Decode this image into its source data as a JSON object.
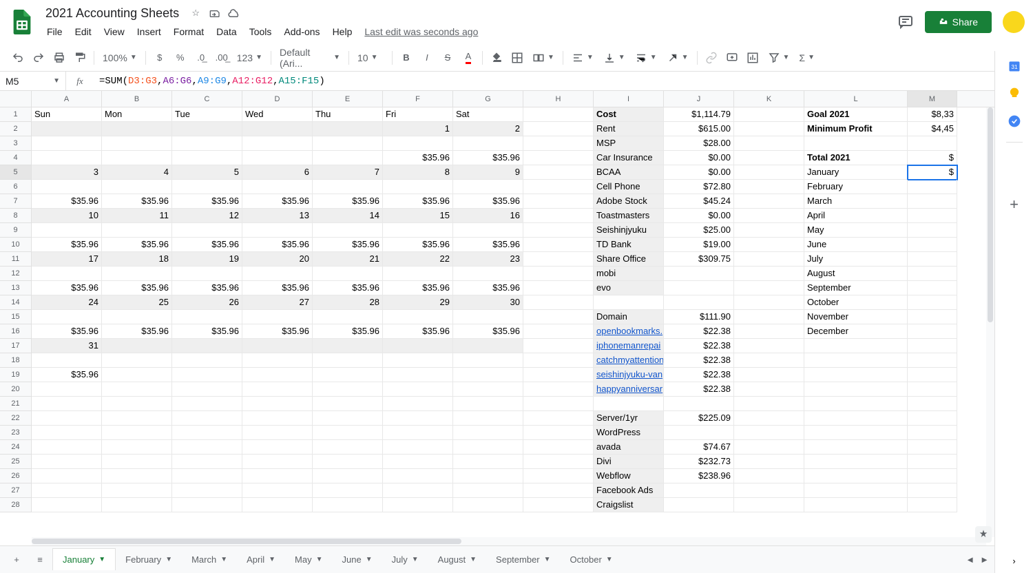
{
  "doc": {
    "title": "2021 Accounting Sheets"
  },
  "menu": {
    "file": "File",
    "edit": "Edit",
    "view": "View",
    "insert": "Insert",
    "format": "Format",
    "data": "Data",
    "tools": "Tools",
    "addons": "Add-ons",
    "help": "Help",
    "lastedit": "Last edit was seconds ago"
  },
  "share": {
    "label": "Share"
  },
  "toolbar": {
    "zoom": "100%",
    "font": "Default (Ari...",
    "size": "10",
    "numfmt": "123"
  },
  "namebox": "M5",
  "formula": {
    "raw": "=SUM(D3:G3,A6:G6,A9:G9,A12:G12,A15:F15)"
  },
  "cols": [
    "A",
    "B",
    "C",
    "D",
    "E",
    "F",
    "G",
    "H",
    "I",
    "J",
    "K",
    "L",
    "M"
  ],
  "rows": 28,
  "activeCell": {
    "row": 5,
    "col": "M"
  },
  "days": {
    "A": "Sun",
    "B": "Mon",
    "C": "Tue",
    "D": "Wed",
    "E": "Thu",
    "F": "Fri",
    "G": "Sat"
  },
  "calendar": {
    "2": {
      "F": "1",
      "G": "2"
    },
    "4": {
      "F": "$35.96",
      "G": "$35.96"
    },
    "5": {
      "A": "3",
      "B": "4",
      "C": "5",
      "D": "6",
      "E": "7",
      "F": "8",
      "G": "9"
    },
    "7": {
      "A": "$35.96",
      "B": "$35.96",
      "C": "$35.96",
      "D": "$35.96",
      "E": "$35.96",
      "F": "$35.96",
      "G": "$35.96"
    },
    "8": {
      "A": "10",
      "B": "11",
      "C": "12",
      "D": "13",
      "E": "14",
      "F": "15",
      "G": "16"
    },
    "10": {
      "A": "$35.96",
      "B": "$35.96",
      "C": "$35.96",
      "D": "$35.96",
      "E": "$35.96",
      "F": "$35.96",
      "G": "$35.96"
    },
    "11": {
      "A": "17",
      "B": "18",
      "C": "19",
      "D": "20",
      "E": "21",
      "F": "22",
      "G": "23"
    },
    "13": {
      "A": "$35.96",
      "B": "$35.96",
      "C": "$35.96",
      "D": "$35.96",
      "E": "$35.96",
      "F": "$35.96",
      "G": "$35.96"
    },
    "14": {
      "A": "24",
      "B": "25",
      "C": "26",
      "D": "27",
      "E": "28",
      "F": "29",
      "G": "30"
    },
    "16": {
      "A": "$35.96",
      "B": "$35.96",
      "C": "$35.96",
      "D": "$35.96",
      "E": "$35.96",
      "F": "$35.96",
      "G": "$35.96"
    },
    "17": {
      "A": "31"
    },
    "19": {
      "A": "$35.96"
    }
  },
  "grayRows": [
    2,
    5,
    8,
    11,
    14,
    17
  ],
  "costs": {
    "1": {
      "I": "Cost",
      "J": "$1,114.79"
    },
    "2": {
      "I": "Rent",
      "J": "$615.00"
    },
    "3": {
      "I": "MSP",
      "J": "$28.00"
    },
    "4": {
      "I": "Car Insurance",
      "J": "$0.00"
    },
    "5": {
      "I": "BCAA",
      "J": "$0.00"
    },
    "6": {
      "I": "Cell Phone",
      "J": "$72.80"
    },
    "7": {
      "I": "Adobe Stock",
      "J": "$45.24"
    },
    "8": {
      "I": "Toastmasters",
      "J": "$0.00"
    },
    "9": {
      "I": "Seishinjyuku",
      "J": "$25.00"
    },
    "10": {
      "I": "TD Bank",
      "J": "$19.00"
    },
    "11": {
      "I": "Share Office",
      "J": "$309.75"
    },
    "12": {
      "I": "mobi",
      "J": ""
    },
    "13": {
      "I": "evo",
      "J": ""
    },
    "15": {
      "I": "Domain",
      "J": "$111.90"
    },
    "16": {
      "I": "openbookmarks.",
      "J": "$22.38",
      "link": true
    },
    "17": {
      "I": "iphonemanrepai",
      "J": "$22.38",
      "link": true
    },
    "18": {
      "I": "catchmyattention",
      "J": "$22.38",
      "link": true
    },
    "19": {
      "I": "seishinjyuku-van",
      "J": "$22.38",
      "link": true
    },
    "20": {
      "I": "happyanniversar",
      "J": "$22.38",
      "link": true
    },
    "22": {
      "I": "Server/1yr",
      "J": "$225.09"
    },
    "23": {
      "I": "WordPress",
      "J": ""
    },
    "24": {
      "I": "avada",
      "J": "$74.67"
    },
    "25": {
      "I": "Divi",
      "J": "$232.73"
    },
    "26": {
      "I": "Webflow",
      "J": "$238.96"
    },
    "27": {
      "I": "Facebook Ads",
      "J": ""
    },
    "28": {
      "I": "Craigslist",
      "J": ""
    }
  },
  "goals": {
    "1": {
      "L": "Goal 2021",
      "M": "$8,33"
    },
    "2": {
      "L": "Minimum Profit",
      "M": "$4,45"
    },
    "4": {
      "L": "Total 2021",
      "M": "$"
    },
    "5": {
      "L": "January",
      "M": "$"
    },
    "6": {
      "L": "February"
    },
    "7": {
      "L": "March"
    },
    "8": {
      "L": "April"
    },
    "9": {
      "L": "May"
    },
    "10": {
      "L": "June"
    },
    "11": {
      "L": "July"
    },
    "12": {
      "L": "August"
    },
    "13": {
      "L": "September"
    },
    "14": {
      "L": "October"
    },
    "15": {
      "L": "November"
    },
    "16": {
      "L": "December"
    }
  },
  "boldCells": [
    "I1",
    "L1",
    "L2",
    "L4"
  ],
  "sheets": [
    "January",
    "February",
    "March",
    "April",
    "May",
    "June",
    "July",
    "August",
    "September",
    "October"
  ],
  "activeSheet": 0
}
